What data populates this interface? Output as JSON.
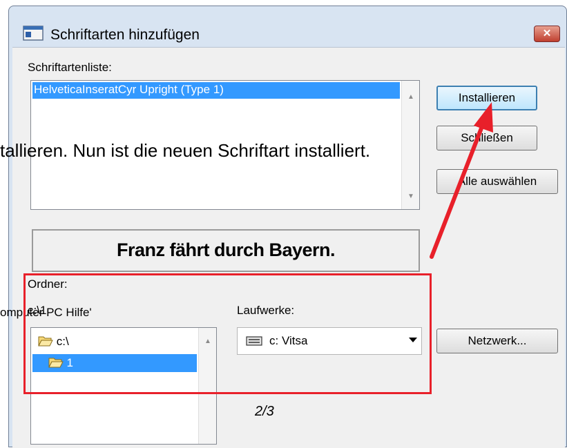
{
  "dialog": {
    "title": "Schriftarten hinzufügen",
    "close_glyph": "✕"
  },
  "font_list": {
    "label": "Schriftartenliste:",
    "items": [
      "HelveticaInseratCyr Upright (Type 1)"
    ],
    "selected_index": 0
  },
  "buttons": {
    "install": "Installieren",
    "close": "Schließen",
    "select_all": "Alle auswählen",
    "network": "Netzwerk..."
  },
  "preview": {
    "text": "Franz fährt durch Bayern."
  },
  "folders": {
    "label": "Ordner:",
    "path": "c:\\1",
    "tree": [
      {
        "name": "c:\\",
        "icon": "folder-open-icon",
        "selected": false
      },
      {
        "name": "1",
        "icon": "folder-open-icon",
        "selected": true
      }
    ]
  },
  "drives": {
    "label": "Laufwerke:",
    "selected": "c: Vitsa",
    "icon": "drive-icon"
  },
  "overlay": {
    "instruction": "tallieren. Nun ist die neuen Schriftart installiert.",
    "breadcrumb": "omputer  PC  Hilfe'",
    "page_number": "2/3"
  },
  "annotation": {
    "color": "#e8202a"
  }
}
